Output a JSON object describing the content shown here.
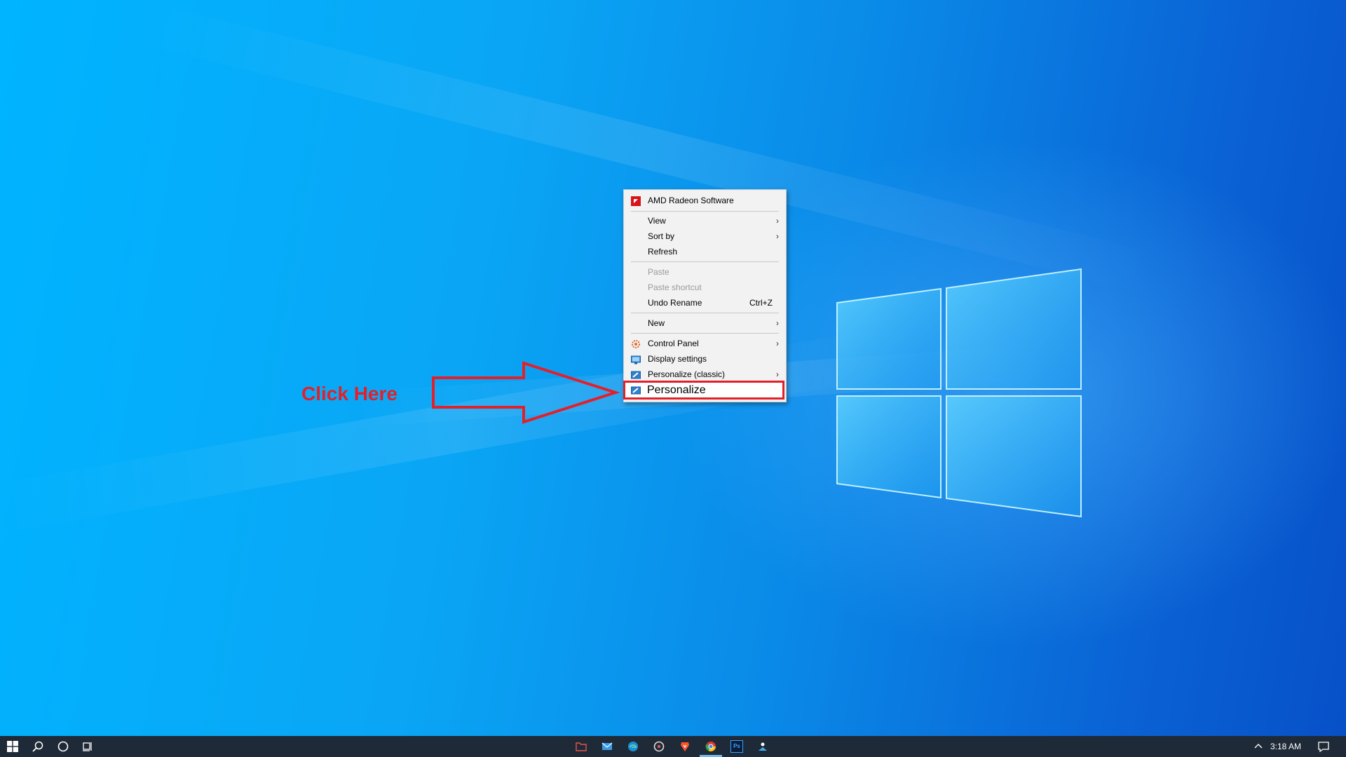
{
  "annotation": {
    "callout_text": "Click Here",
    "callout_color": "#e3202a"
  },
  "context_menu": {
    "items": [
      {
        "label": "AMD Radeon Software",
        "icon": "amd-radeon-icon"
      },
      {
        "label": "View",
        "has_submenu": true
      },
      {
        "label": "Sort by",
        "has_submenu": true
      },
      {
        "label": "Refresh"
      },
      {
        "label": "Paste",
        "disabled": true
      },
      {
        "label": "Paste shortcut",
        "disabled": true
      },
      {
        "label": "Undo Rename",
        "shortcut": "Ctrl+Z"
      },
      {
        "label": "New",
        "has_submenu": true
      },
      {
        "label": "Control Panel",
        "icon": "control-panel-icon",
        "has_submenu": true
      },
      {
        "label": "Display settings",
        "icon": "display-settings-icon"
      },
      {
        "label": "Personalize (classic)",
        "icon": "personalize-classic-icon",
        "has_submenu": true
      },
      {
        "label": "Personalize",
        "icon": "personalize-icon",
        "highlighted": true
      }
    ],
    "submenu_arrow": "›"
  },
  "taskbar": {
    "left_icons": [
      "start-icon",
      "search-icon",
      "cortana-icon",
      "task-view-icon"
    ],
    "pinned_icons": [
      "file-explorer-icon",
      "mail-icon",
      "edge-icon",
      "media-player-icon",
      "brave-icon",
      "chrome-icon",
      "photoshop-icon",
      "app-icon"
    ],
    "photoshop_label": "Ps",
    "tray_chevron": "^",
    "clock": "3:18 AM",
    "notification_icon": "action-center-icon"
  },
  "colors": {
    "desktop_accent": "#0a8ae8",
    "highlight": "#e3202a",
    "taskbar": "#1f2a38"
  }
}
